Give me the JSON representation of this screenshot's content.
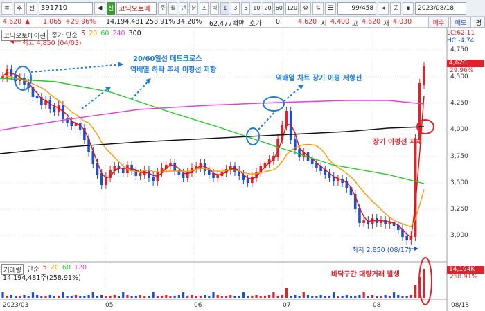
{
  "toolbar": {
    "menu_glyph": "≡",
    "type_label": "주",
    "sub_label": "전",
    "code": "391710",
    "icon_left": "◀",
    "icon_right": "▶",
    "market_tag": "신",
    "name": "코닉오토메",
    "periods": [
      "주",
      "월",
      "년",
      "분",
      "초",
      "틱"
    ],
    "ticks": [
      "1",
      "3",
      "5",
      "10",
      "20",
      "60",
      "120"
    ],
    "count": "99/458",
    "date": "2023/08/18",
    "order_buy": "매수",
    "order_sell": "매도",
    "order_eval": "평"
  },
  "quote": {
    "price": "4,620",
    "change": "1,065",
    "change_pct": "+29.96%",
    "volume": "14,194,481",
    "volume_pct": "258.91%",
    "turnover": "34.20%",
    "amount": "62,477백만",
    "hoga_label": "호가",
    "hoga_val": "0",
    "cur": "4,620",
    "open_label": "시",
    "open": "4,400",
    "high_label": "고",
    "high": "4,620",
    "low_label": "저",
    "low": "4,030"
  },
  "legend": {
    "name": "코닉오토메이션",
    "ma_label": "종가 단순",
    "ma": [
      "5",
      "20",
      "60",
      "240",
      "300"
    ],
    "lc": "LC:62.11",
    "hc": "HC:-4.74",
    "vol_label": "거래량",
    "vol_ma_label": "단순",
    "vol_ma": [
      "5",
      "20",
      "60",
      "120"
    ],
    "vol_value": "14,194,481주(258.91%)"
  },
  "colors": {
    "ma5": "#e01010",
    "ma20": "#ff9900",
    "ma60": "#22cc22",
    "ma240": "#e040e0",
    "ma300": "#111111",
    "up": "#e4202a",
    "down": "#1c4fd6",
    "annot": "#1e7be0"
  },
  "chart_data": {
    "type": "candlestick",
    "y_ticks": [
      "4,750",
      "4,500",
      "4,250",
      "4,000",
      "3,750",
      "3,500",
      "3,250",
      "3,000"
    ],
    "x_ticks": [
      "2023/03",
      "05",
      "06",
      "07",
      "08",
      "08/18"
    ],
    "max_label": "최고 4,850 (04/03)",
    "min_label": "최저 2,850 (08/17)",
    "last_price_tag": "4,620",
    "last_pct_tag": "29.96%",
    "last_vol_tag": "14,194K",
    "last_vol_pct": "258.91%"
  },
  "annotations": {
    "deadcross_1": "20/60일선 데드크로스",
    "deadcross_2": "역배열 하락 추세 이평선 저항",
    "resist": "역배열 차트 장기 이평 저항선",
    "support": "장기 이평선 지지",
    "volume": "바닥구간 대량거래 발생"
  }
}
